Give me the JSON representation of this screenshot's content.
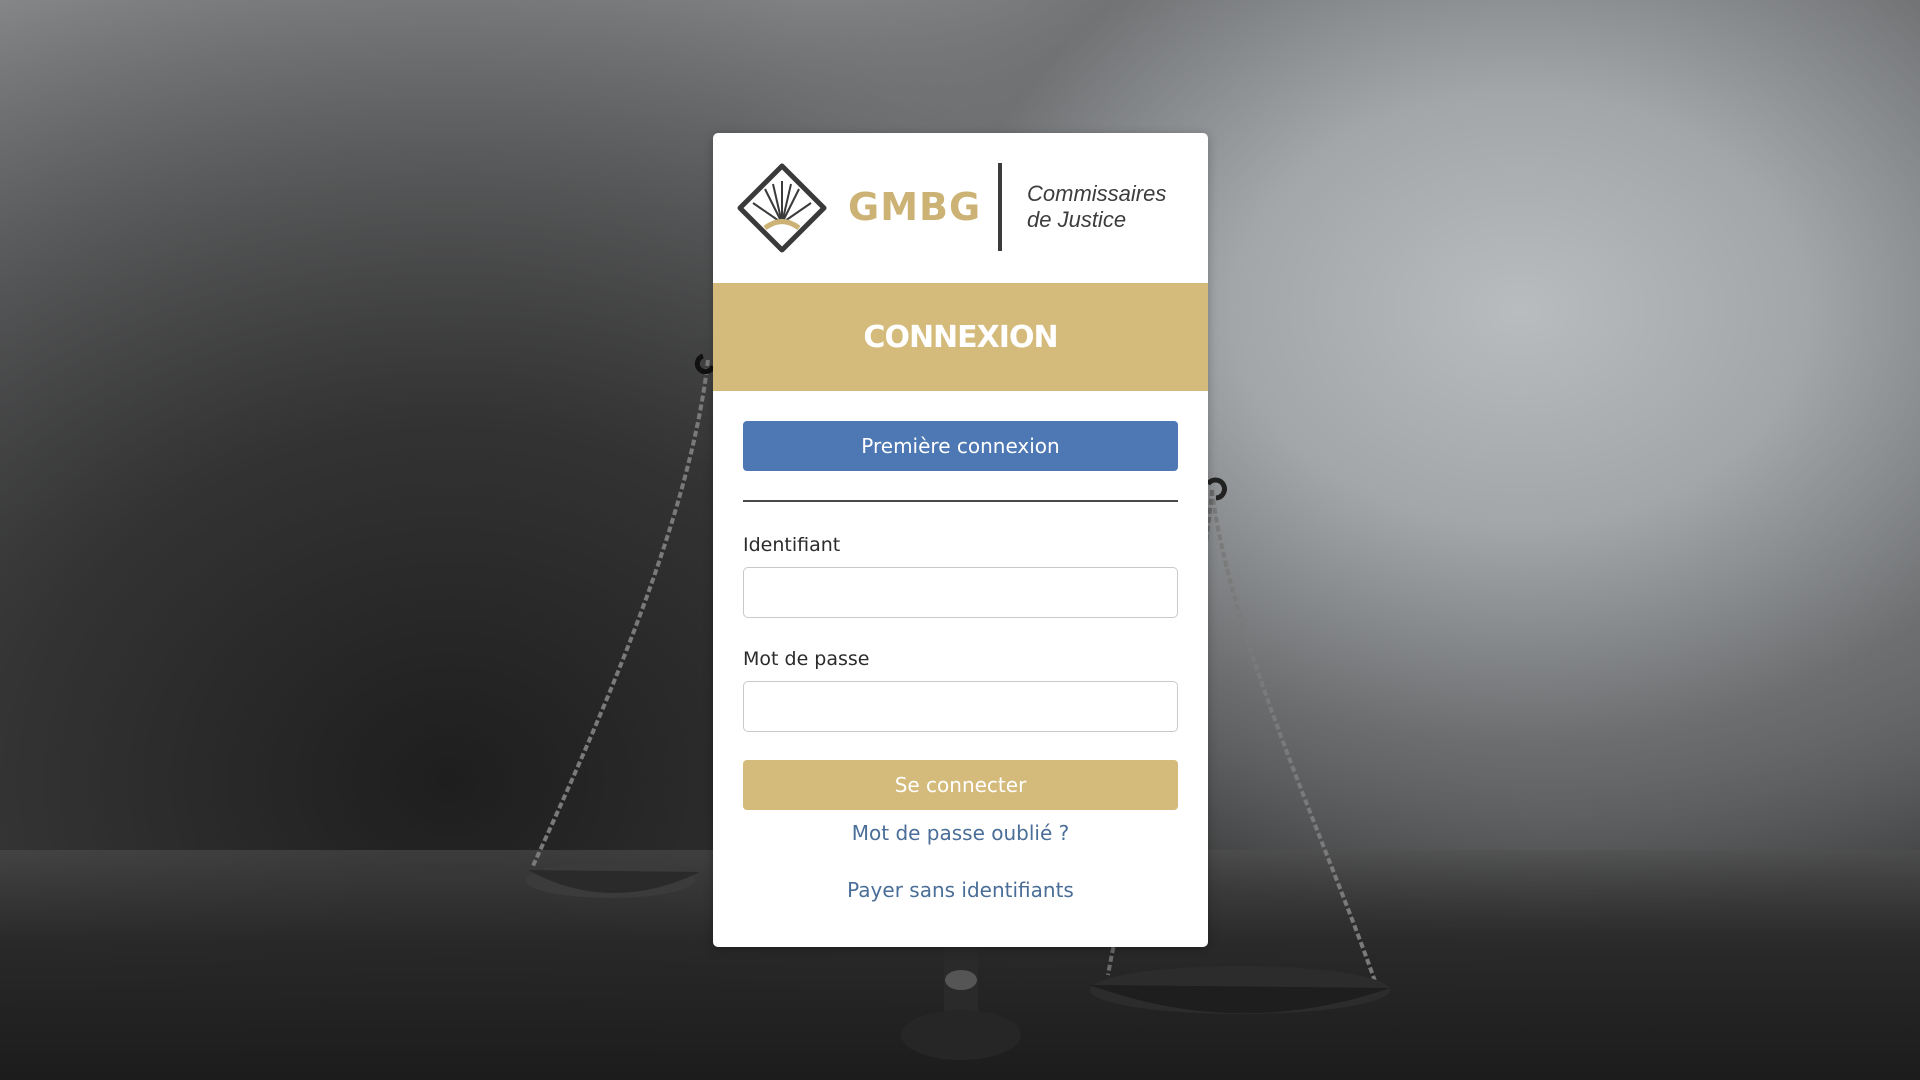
{
  "brand": {
    "name": "GMBG",
    "tagline_line1": "Commissaires",
    "tagline_line2": "de Justice",
    "gold_color": "#d4bb7b",
    "logo_gold": "#ccb274"
  },
  "login": {
    "title": "CONNEXION",
    "first_login_button": "Première connexion",
    "username_label": "Identifiant",
    "username_value": "",
    "password_label": "Mot de passe",
    "password_value": "",
    "submit_button": "Se connecter",
    "forgot_password_link": "Mot de passe oublié ?",
    "pay_without_login_link": "Payer sans identifiants"
  },
  "colors": {
    "primary_blue": "#4d78b4",
    "link_blue": "#4a6e97"
  },
  "background": {
    "image_subject": "scales-of-justice"
  }
}
